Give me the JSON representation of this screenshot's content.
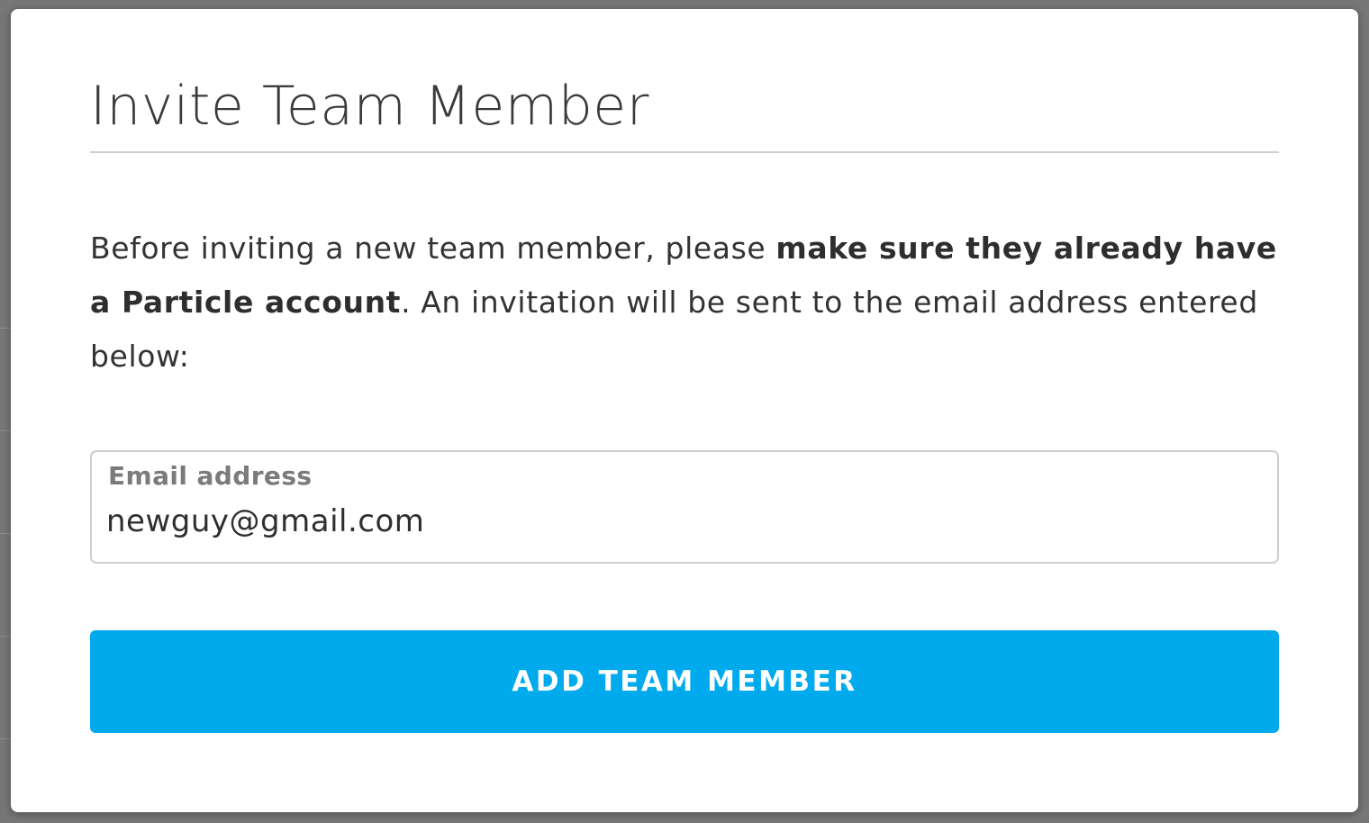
{
  "modal": {
    "title": "Invite Team Member",
    "description": {
      "part1": "Before inviting a new team member, please ",
      "bold": "make sure they already have a Particle account",
      "part2": ". An invitation will be sent to the email address entered below:"
    },
    "email_field": {
      "label": "Email address",
      "value": "newguy@gmail.com"
    },
    "add_button_label": "ADD TEAM MEMBER"
  },
  "colors": {
    "accent": "#00aaed",
    "overlay": "#777777",
    "text": "#333333"
  }
}
